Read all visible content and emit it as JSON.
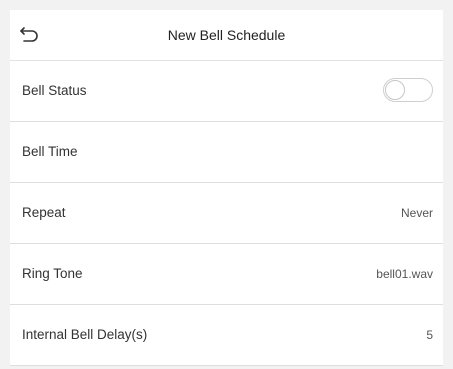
{
  "header": {
    "back_icon": "back-arrow-icon",
    "title": "New Bell Schedule"
  },
  "settings": {
    "bell_status": {
      "label": "Bell Status",
      "enabled": false
    },
    "bell_time": {
      "label": "Bell Time",
      "value": ""
    },
    "repeat": {
      "label": "Repeat",
      "value": "Never"
    },
    "ring_tone": {
      "label": "Ring Tone",
      "value": "bell01.wav"
    },
    "internal_bell_delay": {
      "label": "Internal Bell Delay(s)",
      "value": "5"
    }
  },
  "colors": {
    "background": "#f2f2f2",
    "row_background": "#ffffff",
    "divider": "#dedede",
    "toggle_off_border": "#cfcfcf"
  }
}
